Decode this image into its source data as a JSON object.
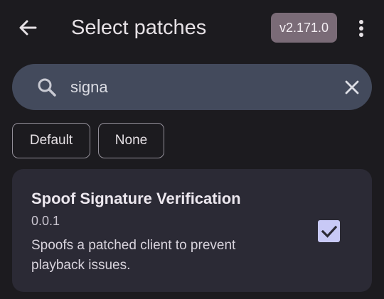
{
  "header": {
    "title": "Select patches",
    "version": "v2.171.0",
    "back_icon": "arrow-back-icon",
    "more_icon": "more-vert-icon"
  },
  "search": {
    "value": "signa",
    "search_icon": "search-icon",
    "clear_icon": "close-icon"
  },
  "filters": [
    {
      "label": "Default"
    },
    {
      "label": "None"
    }
  ],
  "patches": [
    {
      "name": "Spoof Signature Verification",
      "version": "0.0.1",
      "description": "Spoofs a patched client to prevent playback issues.",
      "selected": true
    }
  ],
  "colors": {
    "background": "#1c1b1f",
    "badge": "#7a6b77",
    "search_bar": "#434a5c",
    "card": "#2b2a35",
    "checkbox": "#c8c9f6"
  }
}
